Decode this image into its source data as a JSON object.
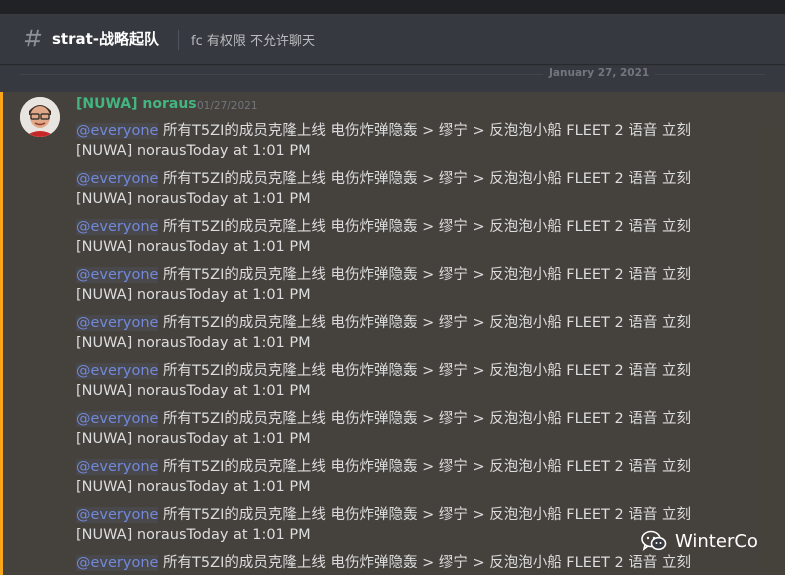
{
  "header": {
    "channel_name": "strat-战略起队",
    "topic": "fc 有权限 不允许聊天"
  },
  "divider": {
    "date": "January 27, 2021"
  },
  "message": {
    "author": "[NUWA] noraus",
    "timestamp": "01/27/2021",
    "author_color": "#43b581",
    "accent_color": "#faa61a"
  },
  "lines": [
    {
      "meta": "",
      "mention": "@everyone",
      "text": " 所有T5ZI的成员克隆上线 电伤炸弹隐轰 > 缪宁 > 反泡泡小船 FLEET 2 语音 立刻"
    },
    {
      "meta": "[NUWA] norausToday at 1:01 PM",
      "mention": "@everyone",
      "text": " 所有T5ZI的成员克隆上线 电伤炸弹隐轰 > 缪宁 > 反泡泡小船 FLEET 2 语音 立刻"
    },
    {
      "meta": "[NUWA] norausToday at 1:01 PM",
      "mention": "@everyone",
      "text": " 所有T5ZI的成员克隆上线 电伤炸弹隐轰 > 缪宁 > 反泡泡小船 FLEET 2 语音 立刻"
    },
    {
      "meta": "[NUWA] norausToday at 1:01 PM",
      "mention": "@everyone",
      "text": " 所有T5ZI的成员克隆上线 电伤炸弹隐轰 > 缪宁 > 反泡泡小船 FLEET 2 语音 立刻"
    },
    {
      "meta": "[NUWA] norausToday at 1:01 PM",
      "mention": "@everyone",
      "text": " 所有T5ZI的成员克隆上线 电伤炸弹隐轰 > 缪宁 > 反泡泡小船 FLEET 2 语音 立刻"
    },
    {
      "meta": "[NUWA] norausToday at 1:01 PM",
      "mention": "@everyone",
      "text": " 所有T5ZI的成员克隆上线 电伤炸弹隐轰 > 缪宁 > 反泡泡小船 FLEET 2 语音 立刻"
    },
    {
      "meta": "[NUWA] norausToday at 1:01 PM",
      "mention": "@everyone",
      "text": " 所有T5ZI的成员克隆上线 电伤炸弹隐轰 > 缪宁 > 反泡泡小船 FLEET 2 语音 立刻"
    },
    {
      "meta": "[NUWA] norausToday at 1:01 PM",
      "mention": "@everyone",
      "text": " 所有T5ZI的成员克隆上线 电伤炸弹隐轰 > 缪宁 > 反泡泡小船 FLEET 2 语音 立刻"
    },
    {
      "meta": "[NUWA] norausToday at 1:01 PM",
      "mention": "@everyone",
      "text": " 所有T5ZI的成员克隆上线 电伤炸弹隐轰 > 缪宁 > 反泡泡小船 FLEET 2 语音 立刻"
    },
    {
      "meta": "[NUWA] norausToday at 1:01 PM",
      "mention": "@everyone",
      "text": " 所有T5ZI的成员克隆上线 电伤炸弹隐轰 > 缪宁 > 反泡泡小船 FLEET 2 语音 立刻"
    }
  ],
  "watermark": {
    "text": "WinterCo",
    "icon": "wechat-icon"
  },
  "icons": {
    "channel": "hash-icon",
    "avatar": "user-avatar"
  },
  "colors": {
    "background": "#36393f",
    "mention": "#7289da",
    "text": "#dcddde"
  }
}
